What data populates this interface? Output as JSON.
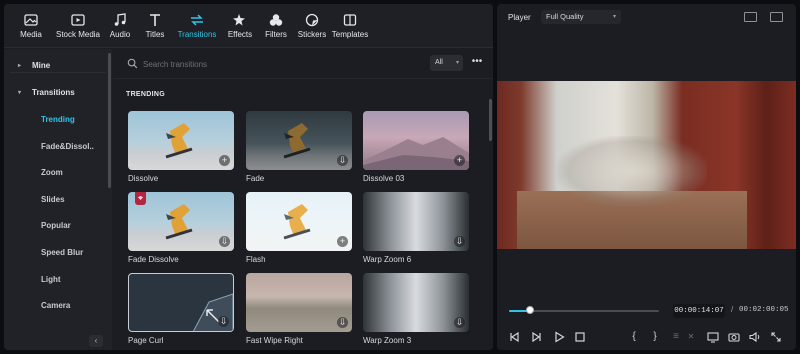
{
  "toolbar": {
    "items": [
      {
        "label": "Media",
        "icon": "media-icon"
      },
      {
        "label": "Stock Media",
        "icon": "stock-media-icon"
      },
      {
        "label": "Audio",
        "icon": "audio-icon"
      },
      {
        "label": "Titles",
        "icon": "titles-icon"
      },
      {
        "label": "Transitions",
        "icon": "transitions-icon",
        "active": true
      },
      {
        "label": "Effects",
        "icon": "effects-icon"
      },
      {
        "label": "Filters",
        "icon": "filters-icon"
      },
      {
        "label": "Stickers",
        "icon": "stickers-icon"
      },
      {
        "label": "Templates",
        "icon": "templates-icon"
      }
    ],
    "accent": "#2ec5e8"
  },
  "sidebar": {
    "groups": [
      {
        "label": "Mine",
        "expanded": false
      },
      {
        "label": "Transitions",
        "expanded": true
      }
    ],
    "items": [
      {
        "label": "Trending",
        "active": true
      },
      {
        "label": "Fade&Dissol.."
      },
      {
        "label": "Zoom"
      },
      {
        "label": "Slides"
      },
      {
        "label": "Popular"
      },
      {
        "label": "Speed Blur"
      },
      {
        "label": "Light"
      },
      {
        "label": "Camera"
      }
    ]
  },
  "search": {
    "placeholder": "Search transitions",
    "filter_label": "All"
  },
  "section": {
    "title": "TRENDING"
  },
  "transitions": [
    {
      "name": "Dissolve",
      "badge": "add"
    },
    {
      "name": "Fade",
      "badge": "download"
    },
    {
      "name": "Dissolve 03",
      "badge": "add"
    },
    {
      "name": "Fade Dissolve",
      "badge": "download",
      "pro": true
    },
    {
      "name": "Flash",
      "badge": "add"
    },
    {
      "name": "Warp Zoom 6",
      "badge": "download"
    },
    {
      "name": "Page Curl",
      "badge": "download"
    },
    {
      "name": "Fast Wipe Right",
      "badge": "download"
    },
    {
      "name": "Warp Zoom 3",
      "badge": "download"
    }
  ],
  "player": {
    "label": "Player",
    "quality": "Full Quality",
    "current_time": "00:00:14:07",
    "separator": "/",
    "total_time": "00:02:00:05",
    "progress": 0.14
  }
}
